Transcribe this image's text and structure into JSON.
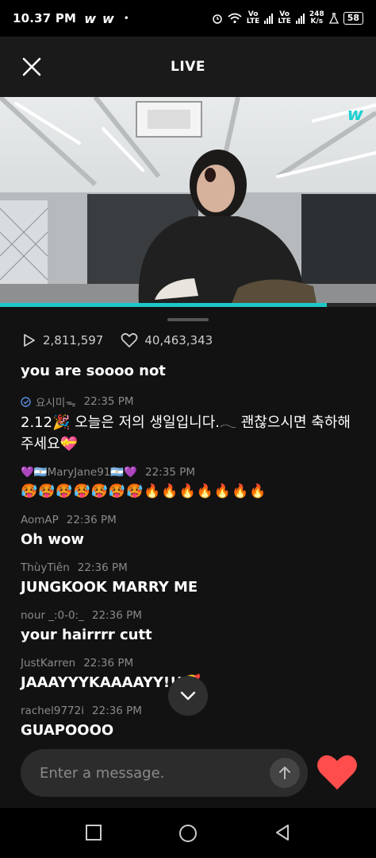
{
  "status_bar": {
    "time": "10.37 PM",
    "app_icons": [
      "w",
      "w"
    ],
    "dot": "•",
    "network_speed": "248",
    "network_unit": "K/s",
    "vo": "Vo",
    "lte": "LTE",
    "battery": "58"
  },
  "header": {
    "title": "LIVE"
  },
  "video": {
    "brand_icon": "weverse-logo",
    "progress": 0.87
  },
  "stats": {
    "plays": "2,811,597",
    "likes": "40,463,343"
  },
  "chat": {
    "partial_message": "you are soooo not",
    "messages": [
      {
        "user": "요시미ᯓ",
        "time": "22:35 PM",
        "text": "2.12🎉 오늘은 저의 생일입니다.𓂃 괜찮으시면 축하해주세요💝",
        "regular": true
      },
      {
        "user": "💜🇦🇷MaryJane91🇦🇷💜",
        "time": "22:35 PM",
        "text": "🥵🥵🥵🥵🥵🥵🥵🔥🔥🔥🔥🔥🔥🔥",
        "regular": true
      },
      {
        "user": "AomAP",
        "time": "22:36 PM",
        "text": "Oh wow"
      },
      {
        "user": "ThùyTiên",
        "time": "22:36 PM",
        "text": "JUNGKOOK MARRY ME"
      },
      {
        "user": "nour _:0-0:_",
        "time": "22:36 PM",
        "text": "your hairrrr cutt"
      },
      {
        "user": "JustKarren",
        "time": "22:36 PM",
        "text": "JAAAYYYKAAAAYY!!!🥰"
      },
      {
        "user": "rachel9772i",
        "time": "22:36 PM",
        "text": "GUAPOOOO"
      }
    ]
  },
  "composer": {
    "placeholder": "Enter a message."
  },
  "colors": {
    "accent": "#1ec7c7",
    "heart": "#ff4d4d",
    "panel": "#121212"
  }
}
